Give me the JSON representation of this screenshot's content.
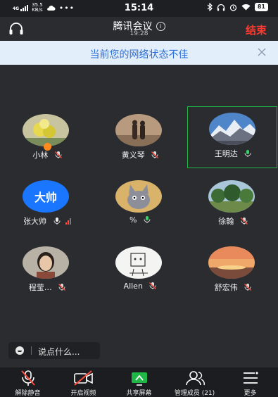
{
  "status_bar": {
    "network": "4G",
    "speed_value": "35.5",
    "speed_unit": "KB/s",
    "time": "15:14",
    "battery": "81"
  },
  "header": {
    "title": "腾讯会议",
    "info_icon": "i",
    "duration": "19:28",
    "end_label": "结束"
  },
  "banner": {
    "text": "当前您的网络状态不佳"
  },
  "participants": [
    {
      "name": "小林",
      "mic": "muted",
      "host": true,
      "active": false,
      "avatar": "photo-flowers"
    },
    {
      "name": "黄义琴",
      "mic": "muted",
      "host": false,
      "active": false,
      "avatar": "photo-couple"
    },
    {
      "name": "王明达",
      "mic": "on",
      "host": false,
      "active": true,
      "avatar": "photo-mountain"
    },
    {
      "name": "张大帅",
      "mic": "on",
      "host": false,
      "active": false,
      "avatar_text": "大帅",
      "signal": "weak"
    },
    {
      "name": "%",
      "mic": "on",
      "host": false,
      "active": false,
      "avatar": "photo-cartoon-cat"
    },
    {
      "name": "徐翰",
      "mic": "muted",
      "host": false,
      "active": false,
      "avatar": "photo-trees"
    },
    {
      "name": "程莹…",
      "mic": "muted",
      "host": false,
      "active": false,
      "avatar": "photo-woman"
    },
    {
      "name": "Allen",
      "mic": "muted",
      "host": false,
      "active": false,
      "avatar": "photo-drawing"
    },
    {
      "name": "舒宏伟",
      "mic": "muted",
      "host": false,
      "active": false,
      "avatar": "photo-sunset"
    }
  ],
  "chat": {
    "placeholder": "说点什么..."
  },
  "pager": {
    "pages": 3,
    "current": 1
  },
  "toolbar": {
    "unmute_label": "解除静音",
    "video_label": "开启视频",
    "share_label": "共享屏幕",
    "members_label": "管理成员 (21)",
    "more_label": "更多"
  },
  "colors": {
    "end_red": "#ff3b30",
    "banner_blue": "#2b6fd8",
    "active_green": "#1fb848",
    "mute_red": "#ff4b3d",
    "mic_green": "#3ad06a"
  }
}
